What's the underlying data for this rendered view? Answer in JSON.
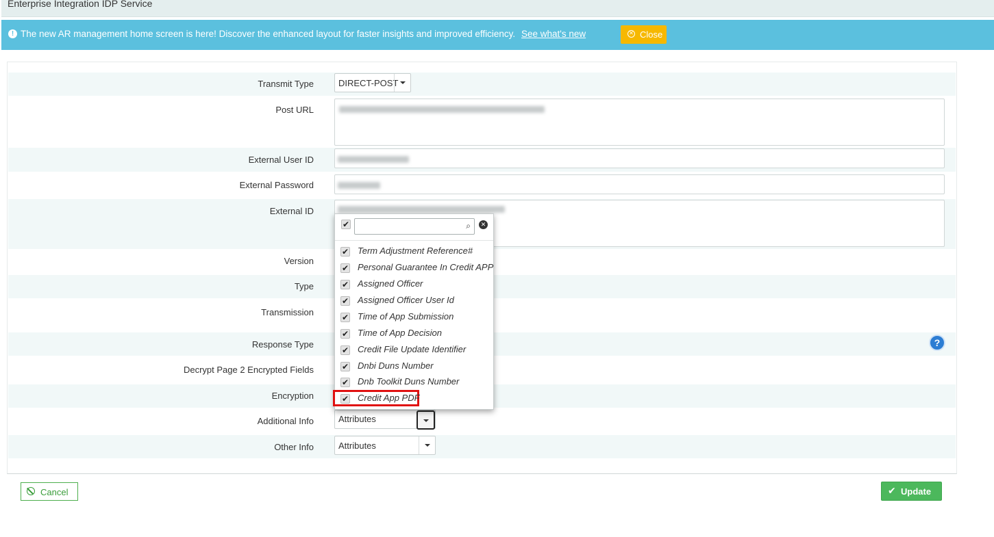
{
  "page_title": "Enterprise Integration IDP Service",
  "banner": {
    "message": "The new AR management home screen is here! Discover the enhanced layout for faster insights and improved efficiency.",
    "link": "See what's new",
    "close": "Close",
    "icon": "info-circle-icon",
    "color": "#5bc0de"
  },
  "form": {
    "transmit_type": {
      "label": "Transmit Type",
      "value": "DIRECT-POST"
    },
    "post_url": {
      "label": "Post URL"
    },
    "external_user_id": {
      "label": "External User ID"
    },
    "external_password": {
      "label": "External Password"
    },
    "external_id": {
      "label": "External ID"
    },
    "version": {
      "label": "Version"
    },
    "type": {
      "label": "Type"
    },
    "transmission": {
      "label": "Transmission"
    },
    "response_type": {
      "label": "Response Type"
    },
    "decrypt_page2": {
      "label": "Decrypt Page 2 Encrypted Fields"
    },
    "encryption": {
      "label": "Encryption"
    },
    "additional_info": {
      "label": "Additional Info",
      "value": "Attributes"
    },
    "other_info": {
      "label": "Other Info",
      "value": "Attributes"
    }
  },
  "dropdown": {
    "search_value": "",
    "items": [
      {
        "label": "Term Adjustment Reference#",
        "checked": true
      },
      {
        "label": "Personal Guarantee In Credit APP",
        "checked": true
      },
      {
        "label": "Assigned Officer",
        "checked": true
      },
      {
        "label": "Assigned Officer User Id",
        "checked": true
      },
      {
        "label": "Time of App Submission",
        "checked": true
      },
      {
        "label": "Time of App Decision",
        "checked": true
      },
      {
        "label": "Credit File Update Identifier",
        "checked": true
      },
      {
        "label": "Dnbi Duns Number",
        "checked": true
      },
      {
        "label": "Dnb Toolkit Duns Number",
        "checked": true
      },
      {
        "label": "Credit App PDF",
        "checked": true,
        "highlighted": true
      }
    ]
  },
  "buttons": {
    "cancel": "Cancel",
    "update": "Update",
    "cancel_color": "#4cae4c",
    "update_color": "#4cb85c"
  }
}
